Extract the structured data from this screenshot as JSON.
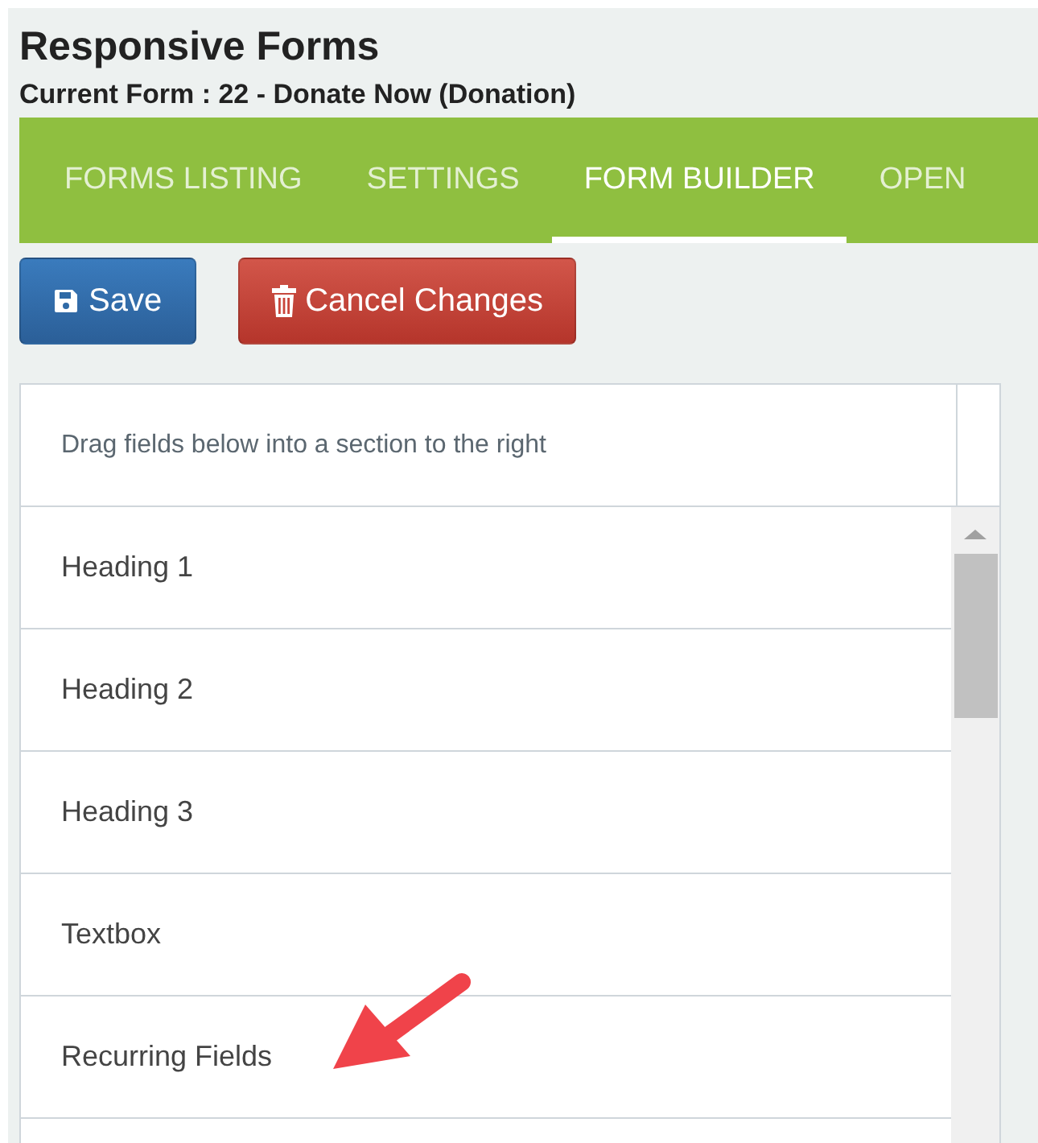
{
  "page": {
    "title": "Responsive Forms",
    "subtitle": "Current Form : 22 - Donate Now (Donation)"
  },
  "tabs": [
    {
      "label": "FORMS LISTING",
      "selected": false
    },
    {
      "label": "SETTINGS",
      "selected": false
    },
    {
      "label": "FORM BUILDER",
      "selected": true
    },
    {
      "label": "OPEN",
      "selected": false
    }
  ],
  "buttons": [
    {
      "label": "Save",
      "kind": "save"
    },
    {
      "label": "Cancel Changes",
      "kind": "cancel"
    }
  ],
  "field_list": {
    "hint": "Drag fields below into a section to the right",
    "items": [
      {
        "label": "Heading 1"
      },
      {
        "label": "Heading 2"
      },
      {
        "label": "Heading 3"
      },
      {
        "label": "Textbox"
      },
      {
        "label": "Recurring Fields"
      }
    ]
  }
}
